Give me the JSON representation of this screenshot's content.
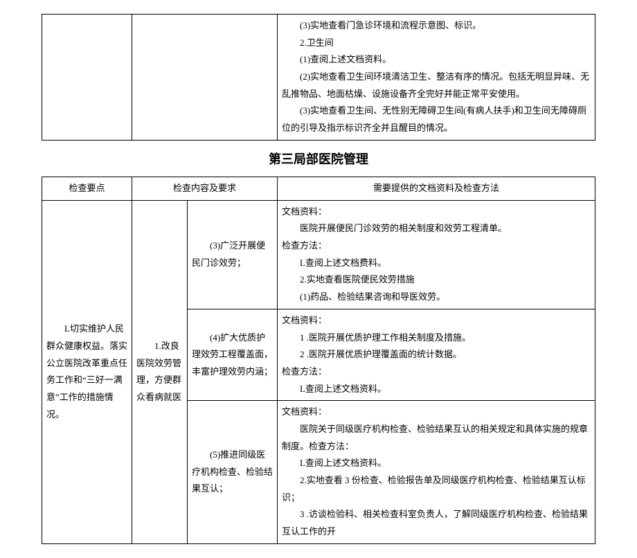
{
  "top_table": {
    "cell_content": "(3)实地查看门急诊环境和流程示意图、标识。\n2.卫生间\n(1)查阅上述文档资料。\n(2)实地查看卫生间环境清洁卫生、整洁有序的情况。包括无明显异味、无乱推物品、地面枯燥、设施设备齐全完好并能正常平安使用。\n(3)实地查看卫生间、无性别无障碍卫生间(有病人扶手)和卫生间无障碍厕位的引导及指示标识齐全并且醒目的情况。"
  },
  "section_title": "第三局部医院管理",
  "table2": {
    "headers": {
      "h1": "检查要点",
      "h2": "检查内容及要求",
      "h3": "需要提供的文档资料及检查方法"
    },
    "rows": [
      {
        "point": "L切实维护人民群众健康权益。落实公立医院改革重点任务工作和“三好一满意”工作的措施情况。",
        "subcontent_label": "1.改良医院效劳管理，方便群众看病就医",
        "items": [
          {
            "req": "(3)广泛开展便民门诊效劳；",
            "doc": "文档资料：\n医院开展便民门诊效劳的相关制度和效劳工程清单。\n检查方法：\nL查阅上述文档费料。\n2.实地查看医院便民效劳措施\n(1)药品、检验结果咨询和导医效劳。"
          },
          {
            "req": "(4)扩大优质护理效劳工程覆盖面，丰富护理效劳内涵；",
            "doc": "文档资料：\n1 .医院开展优质护理工作相关制度及措施。\n2 .医院开展优质护理覆盖面的统计数据。\n检查方法：\nL查阅上述文档资料。"
          },
          {
            "req": "(5)推进同级医疗机构检查、检验结果互认；",
            "doc": "文档资料：\n医院关于同级医疗机构检查、检验结果互认的相关规定和具体实施的规章制度。检查方法：\nL查阅上述文档资料。\n2.实地查看 3 份检查、检验报告单及同级医疗机构检查、检验结果互认标识；\n3 .访谈检验科、相关检查科室负责人，了解同级医疗机构检查、检验结果互认工作的开"
          }
        ]
      }
    ]
  }
}
